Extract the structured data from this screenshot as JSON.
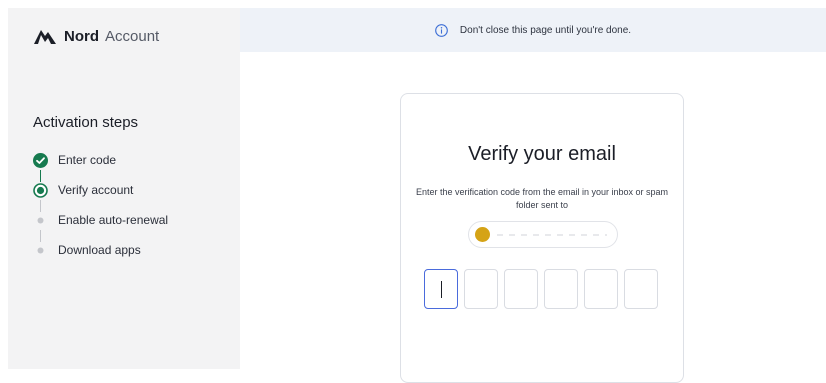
{
  "header": {
    "brand": "Nord",
    "brand_suffix": "Account",
    "logo_icon": "nord-mountain-icon"
  },
  "banner": {
    "icon": "info-icon",
    "text": "Don't close this page until you're done."
  },
  "sidebar": {
    "title": "Activation steps",
    "steps": [
      {
        "label": "Enter code",
        "status": "completed"
      },
      {
        "label": "Verify account",
        "status": "current"
      },
      {
        "label": "Enable auto-renewal",
        "status": "pending"
      },
      {
        "label": "Download apps",
        "status": "pending"
      }
    ]
  },
  "card": {
    "title": "Verify your email",
    "description": "Enter the verification code from the email in your inbox or spam folder sent to",
    "email": "",
    "code_digits": [
      "",
      "",
      "",
      "",
      "",
      ""
    ],
    "active_digit_index": 0
  },
  "colors": {
    "completed": "#167a4f",
    "current": "#167a4f",
    "pending": "#c4c6cb",
    "active_border": "#4a6bdc",
    "banner_bg": "#eef2f8",
    "sidebar_bg": "#f3f3f4",
    "avatar": "#d5a316"
  }
}
